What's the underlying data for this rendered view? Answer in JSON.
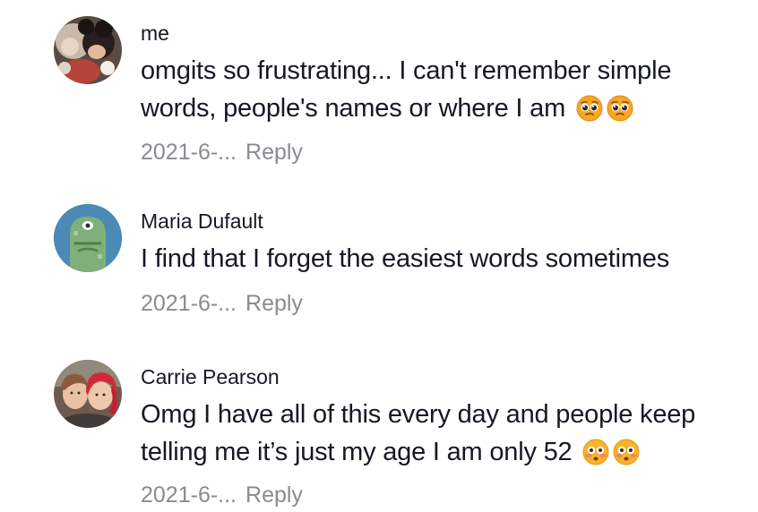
{
  "comments": [
    {
      "username": "me",
      "text": "omgits so frustrating... I can't remember simple words, people's names or where I am",
      "emojis": [
        "pleading-face",
        "pleading-face"
      ],
      "date": "2021-6-...",
      "reply_label": "Reply"
    },
    {
      "username": "Maria Dufault",
      "text": "I find that I forget the easiest words sometimes",
      "emojis": [],
      "date": "2021-6-...",
      "reply_label": "Reply"
    },
    {
      "username": "Carrie Pearson",
      "text": "Omg I have all of this every day and people keep telling me it’s just my age I am only 52",
      "emojis": [
        "flushed-face",
        "flushed-face"
      ],
      "date": "2021-6-...",
      "reply_label": "Reply"
    }
  ]
}
